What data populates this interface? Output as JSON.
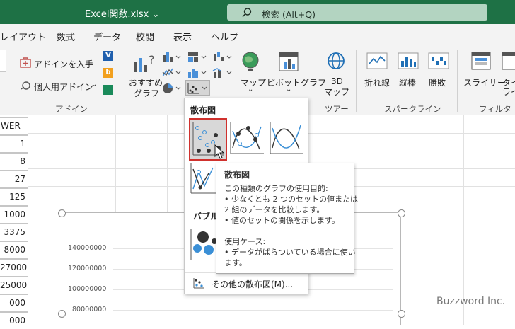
{
  "titlebar": {
    "file_title": "Excel関数.xlsx ⌄",
    "search_text": "検索 (Alt+Q)"
  },
  "menu": {
    "tabs": [
      "レイアウト",
      "数式",
      "データ",
      "校閲",
      "表示",
      "ヘルプ"
    ]
  },
  "ribbon": {
    "addin_store": "アドインを入手",
    "personal_addin": "個人用アドイン",
    "recommended_line1": "おすすめ",
    "recommended_line2": "グラフ",
    "map_label": "マップ",
    "pivot_label": "ピボットグラフ",
    "map3d_line1": "3D",
    "map3d_line2": "マップ",
    "spark_line": "折れ線",
    "spark_column": "縦棒",
    "spark_winloss": "勝敗",
    "slicer": "スライサー",
    "timeline": "タイ",
    "timeline2": "ライ",
    "groups": {
      "addin": "アドイン",
      "tour": "ツアー",
      "sparkline": "スパークライン",
      "filter": "フィルター"
    }
  },
  "sheet": {
    "column_header": "WER",
    "values": [
      "1",
      "8",
      "27",
      "125",
      "1000",
      "3375",
      "8000",
      "27000",
      "25000",
      "000",
      "000"
    ]
  },
  "chart": {
    "y_ticks": [
      "140000000",
      "120000000",
      "100000000",
      "80000000"
    ]
  },
  "dropdown": {
    "scatter_heading": "散布図",
    "bubble_heading": "バブル",
    "more_link": "その他の散布図(M)..."
  },
  "tooltip": {
    "title": "散布図",
    "lines": [
      "この種類のグラフの使用目的:",
      "• 少なくとも 2 つのセットの値または",
      "2 組のデータを比較します。",
      "• 値のセットの関係を示します。",
      "",
      "使用ケース:",
      "• データがばらついている場合に使い",
      "ます。"
    ]
  },
  "watermark": "Buzzword Inc.",
  "colors": {
    "title_bar": "#1e7145",
    "search_bg": "#b3d4c1",
    "highlight": "#d0312d",
    "chart_blue": "#4a90d9"
  }
}
